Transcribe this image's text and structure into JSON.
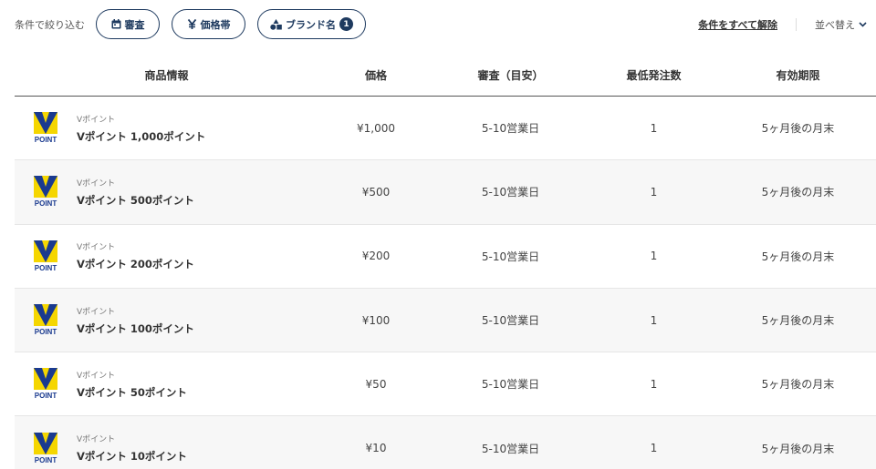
{
  "filters": {
    "label": "条件で絞り込む",
    "chips": [
      {
        "label": "審査",
        "icon": "calendar-icon"
      },
      {
        "label": "価格帯",
        "icon": "yen-icon"
      },
      {
        "label": "ブランド名",
        "icon": "shapes-icon",
        "badge": "1"
      }
    ],
    "clear_all": "条件をすべて解除",
    "sort_label": "並べ替え"
  },
  "table": {
    "headers": {
      "info": "商品情報",
      "price": "価格",
      "review": "審査（目安）",
      "min_order": "最低発注数",
      "expiry": "有効期限"
    },
    "logo_text": "POINT",
    "colors": {
      "logo_yellow": "#f5d600",
      "logo_blue": "#1a3a8f"
    },
    "rows": [
      {
        "brand": "Vポイント",
        "name": "Vポイント 1,000ポイント",
        "price": "¥1,000",
        "review": "5-10営業日",
        "min_order": "1",
        "expiry": "5ヶ月後の月末"
      },
      {
        "brand": "Vポイント",
        "name": "Vポイント 500ポイント",
        "price": "¥500",
        "review": "5-10営業日",
        "min_order": "1",
        "expiry": "5ヶ月後の月末"
      },
      {
        "brand": "Vポイント",
        "name": "Vポイント 200ポイント",
        "price": "¥200",
        "review": "5-10営業日",
        "min_order": "1",
        "expiry": "5ヶ月後の月末"
      },
      {
        "brand": "Vポイント",
        "name": "Vポイント 100ポイント",
        "price": "¥100",
        "review": "5-10営業日",
        "min_order": "1",
        "expiry": "5ヶ月後の月末"
      },
      {
        "brand": "Vポイント",
        "name": "Vポイント 50ポイント",
        "price": "¥50",
        "review": "5-10営業日",
        "min_order": "1",
        "expiry": "5ヶ月後の月末"
      },
      {
        "brand": "Vポイント",
        "name": "Vポイント 10ポイント",
        "price": "¥10",
        "review": "5-10営業日",
        "min_order": "1",
        "expiry": "5ヶ月後の月末"
      }
    ]
  }
}
